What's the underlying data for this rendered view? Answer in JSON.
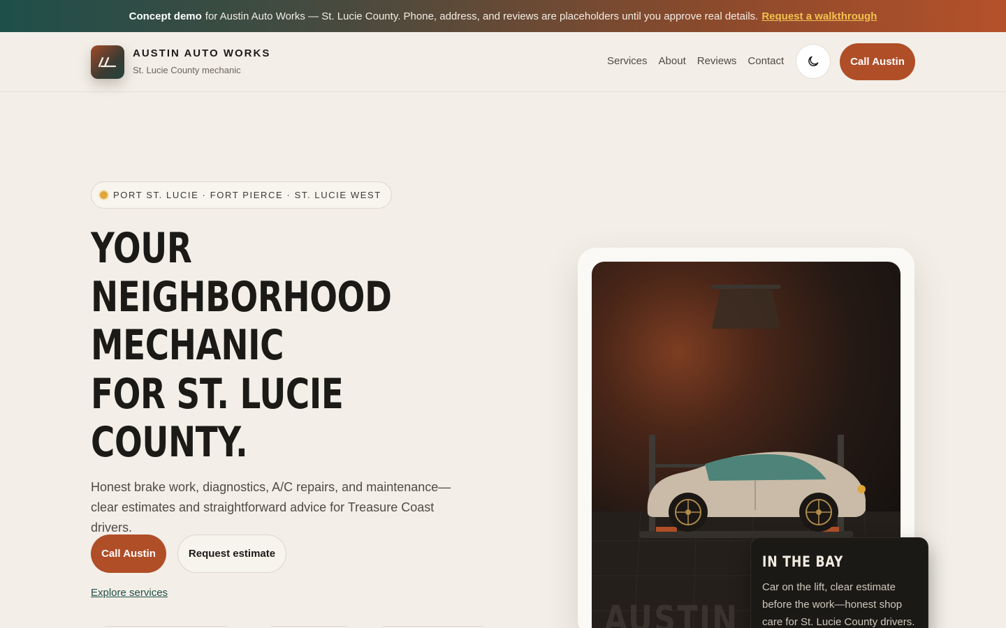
{
  "banner": {
    "lead": "Concept demo",
    "text": "for Austin Auto Works — St. Lucie County. Phone, address, and reviews are placeholders until you approve real details.",
    "link": "Request a walkthrough"
  },
  "header": {
    "brand_name": "AUSTIN AUTO WORKS",
    "brand_sub": "St. Lucie County mechanic",
    "nav": [
      "Services",
      "About",
      "Reviews",
      "Contact"
    ],
    "theme_icon": "moon-icon",
    "call_label": "Call Austin"
  },
  "hero": {
    "pill": "PORT ST. LUCIE · FORT PIERCE · ST. LUCIE WEST",
    "headline_lines": [
      "YOUR",
      "NEIGHBORHOOD",
      "MECHANIC",
      "FOR ST. LUCIE",
      "COUNTY."
    ],
    "lede": "Honest brake work, diagnostics, A/C repairs, and maintenance—clear estimates and straightforward advice for Treasure Coast drivers.",
    "cta_primary": "Call Austin",
    "cta_secondary": "Request estimate",
    "explore": "Explore services"
  },
  "card": {
    "scene_watermark": "AUSTIN",
    "bay_title": "IN THE BAY",
    "bay_text": "Car on the lift, clear estimate before the work—honest shop care for St. Lucie County drivers."
  },
  "colors": {
    "accent": "#b04e28",
    "teal": "#1f4f4a",
    "gold": "#e0a63a",
    "background": "#f3efe8"
  }
}
